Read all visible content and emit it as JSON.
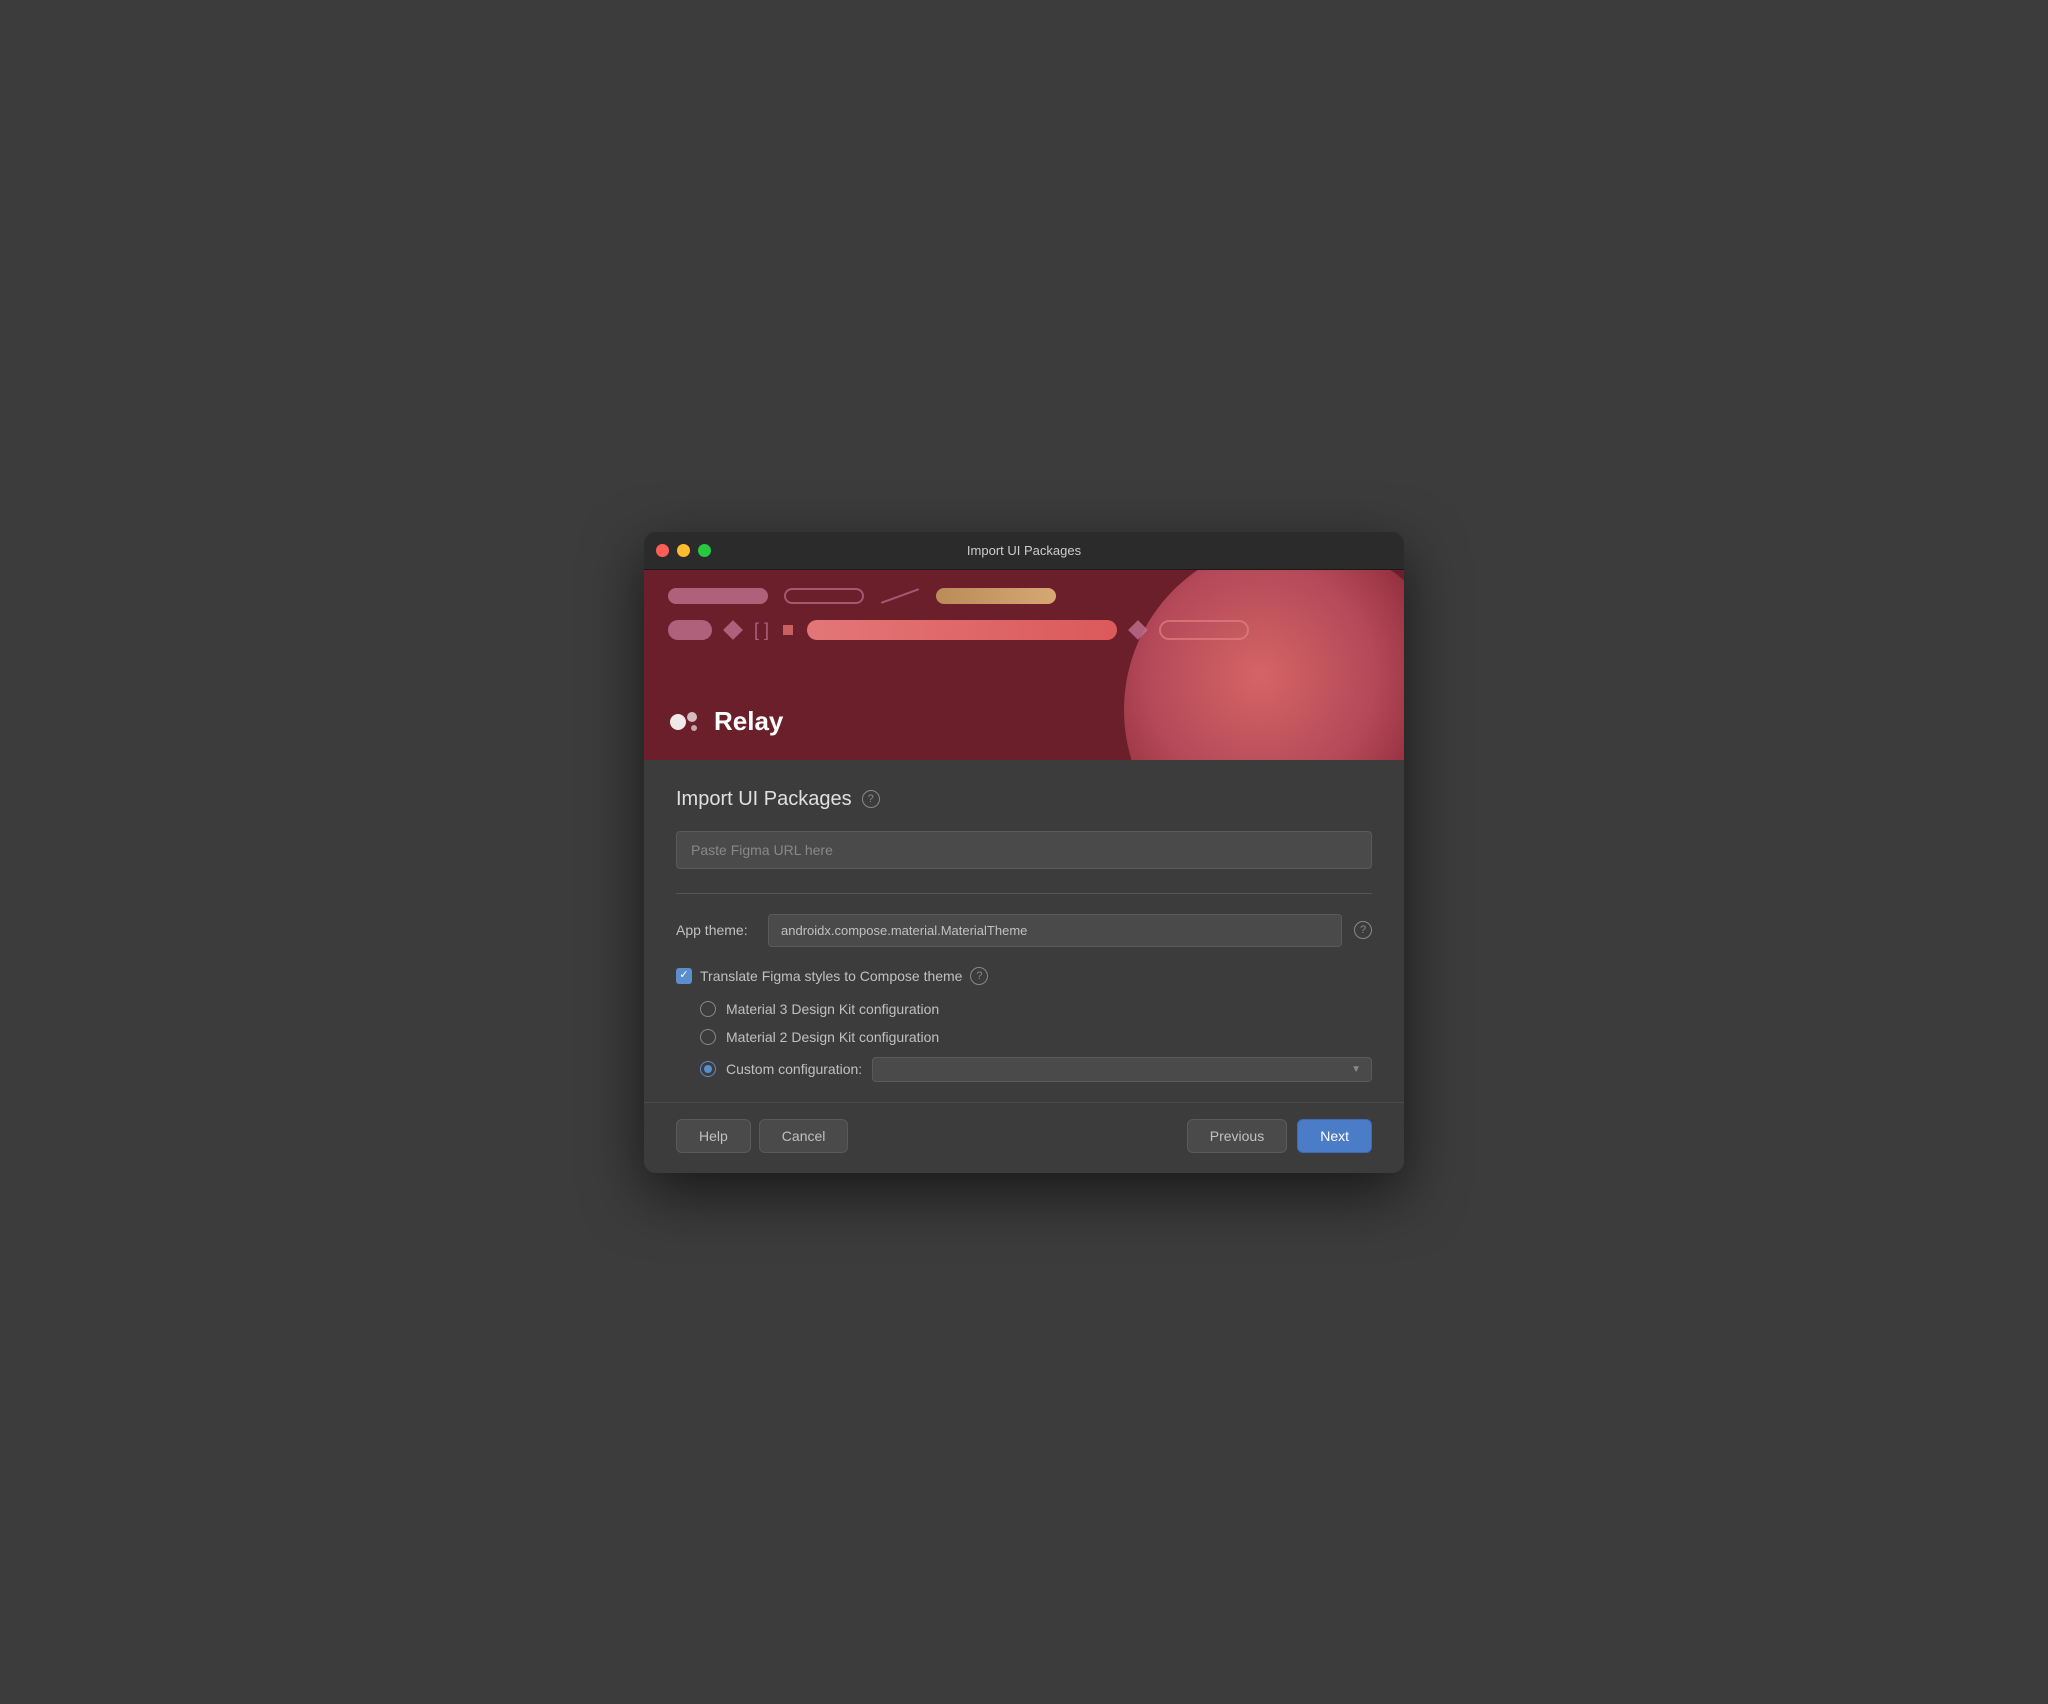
{
  "window": {
    "title": "Import UI Packages"
  },
  "banner": {
    "logo_text": "Relay"
  },
  "content": {
    "page_title": "Import UI Packages",
    "help_icon": "?",
    "url_input_placeholder": "Paste Figma URL here",
    "app_theme_label": "App theme:",
    "app_theme_value": "androidx.compose.material.MaterialTheme",
    "translate_checkbox_label": "Translate Figma styles to Compose theme",
    "translate_checked": true,
    "radio_options": [
      {
        "id": "material3",
        "label": "Material 3 Design Kit configuration",
        "selected": false
      },
      {
        "id": "material2",
        "label": "Material 2 Design Kit configuration",
        "selected": false
      },
      {
        "id": "custom",
        "label": "Custom configuration:",
        "selected": true
      }
    ]
  },
  "footer": {
    "help_label": "Help",
    "cancel_label": "Cancel",
    "previous_label": "Previous",
    "next_label": "Next"
  }
}
